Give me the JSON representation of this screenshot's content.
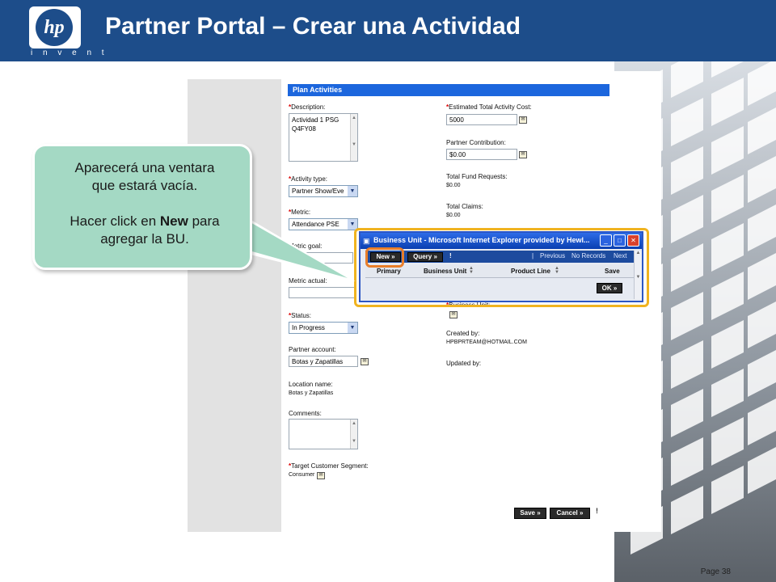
{
  "header": {
    "logo_text": "hp",
    "logo_sub": "i n v e n t",
    "title": "Partner Portal – Crear una Actividad"
  },
  "form": {
    "title": "Plan Activities",
    "required_mark": "*",
    "description": {
      "label": "Description:",
      "value_line1": "Actividad 1 PSG",
      "value_line2": "Q4FY08"
    },
    "activity_type": {
      "label": "Activity type:",
      "value": "Partner Show/Eve"
    },
    "metric": {
      "label": "Metric:",
      "value": "Attendance PSE"
    },
    "metric_goal": {
      "label": "Metric goal:"
    },
    "metric_actual": {
      "label": "Metric actual:"
    },
    "status": {
      "label": "Status:",
      "value": "In Progress"
    },
    "partner_account": {
      "label": "Partner account:",
      "value": "Botas y Zapatillas"
    },
    "location_name": {
      "label": "Location name:",
      "value": "Botas y Zapatillas"
    },
    "comments": {
      "label": "Comments:"
    },
    "target_segment": {
      "label": "Target Customer Segment:",
      "value": "Consumer"
    },
    "est_cost": {
      "label": "Estimated Total Activity Cost:",
      "value": "5000"
    },
    "partner_contribution": {
      "label": "Partner Contribution:",
      "value": "$0.00"
    },
    "fund_requests": {
      "label": "Total Fund Requests:",
      "value": "$0.00"
    },
    "claims": {
      "label": "Total Claims:",
      "value": "$0.00"
    },
    "business_unit": {
      "label": "Business Unit:"
    },
    "created_by": {
      "label": "Created by:",
      "value": "HPBPRTEAM@HOTMAIL.COM"
    },
    "updated_by": {
      "label": "Updated by:"
    },
    "save_label": "Save »",
    "cancel_label": "Cancel »"
  },
  "popup": {
    "title": "Business Unit - Microsoft Internet Explorer provided by Hewl...",
    "new_label": "New »",
    "query_label": "Query »",
    "previous": "Previous",
    "no_records": "No Records",
    "next": "Next",
    "separator": "|",
    "columns": [
      "Primary",
      "Business Unit",
      "Product Line",
      "Save"
    ],
    "ok_label": "OK »"
  },
  "callout": {
    "line1": "Aparecerá una ventara",
    "line2": "que estará vacía.",
    "line3_pre": "Hacer click en ",
    "line3_bold": "New",
    "line3_post": " para",
    "line4": "agregar la BU."
  },
  "footer": {
    "page": "Page 38"
  },
  "colors": {
    "header_bg": "#1d4d8a",
    "callout_bg": "#a4d9c4",
    "form_title_bg": "#1c66dd",
    "highlight": "#f0b320",
    "new_highlight": "#e87e2a"
  }
}
